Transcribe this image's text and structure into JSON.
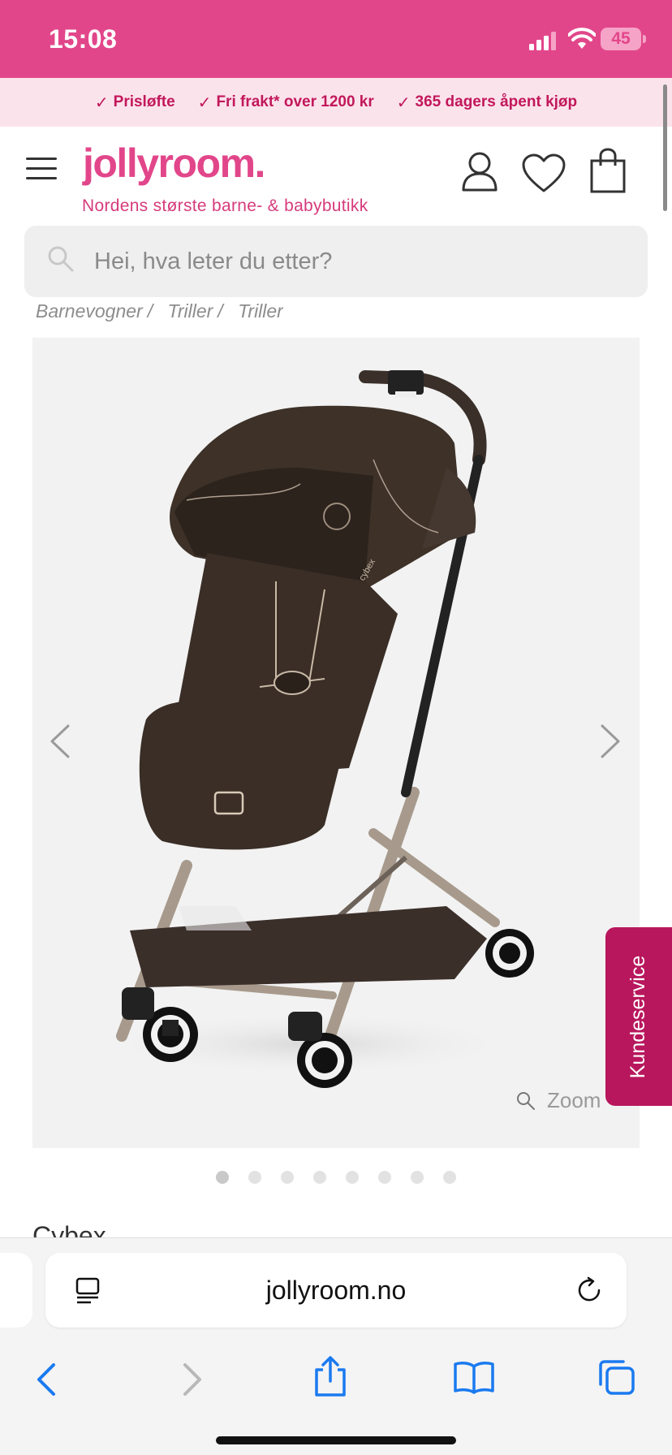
{
  "status_bar": {
    "time": "15:08",
    "battery": "45"
  },
  "usp": {
    "items": [
      "Prisløfte",
      "Fri frakt* over 1200 kr",
      "365 dagers åpent kjøp"
    ],
    "check_glyph": "✓"
  },
  "header": {
    "logo": "jollyroom.",
    "tagline": "Nordens største barne- & babybutikk",
    "icons": [
      "menu-icon",
      "account-icon",
      "heart-icon",
      "cart-icon"
    ]
  },
  "search": {
    "placeholder": "Hei, hva leter du etter?"
  },
  "breadcrumb": {
    "items": [
      "Barnevogner",
      "Triller",
      "Triller"
    ],
    "separator": "/"
  },
  "product": {
    "brand": "Cybex",
    "zoom_label": "Zoom",
    "image_count": 8,
    "active_image_index": 0,
    "stroller_logo": "cybex"
  },
  "kundeservice": {
    "label": "Kundeservice"
  },
  "browser": {
    "url": "jollyroom.no"
  },
  "colors": {
    "brand_pink": "#e2468a",
    "usp_bg": "#fbe3ec",
    "kundeservice_bg": "#b8175d"
  }
}
